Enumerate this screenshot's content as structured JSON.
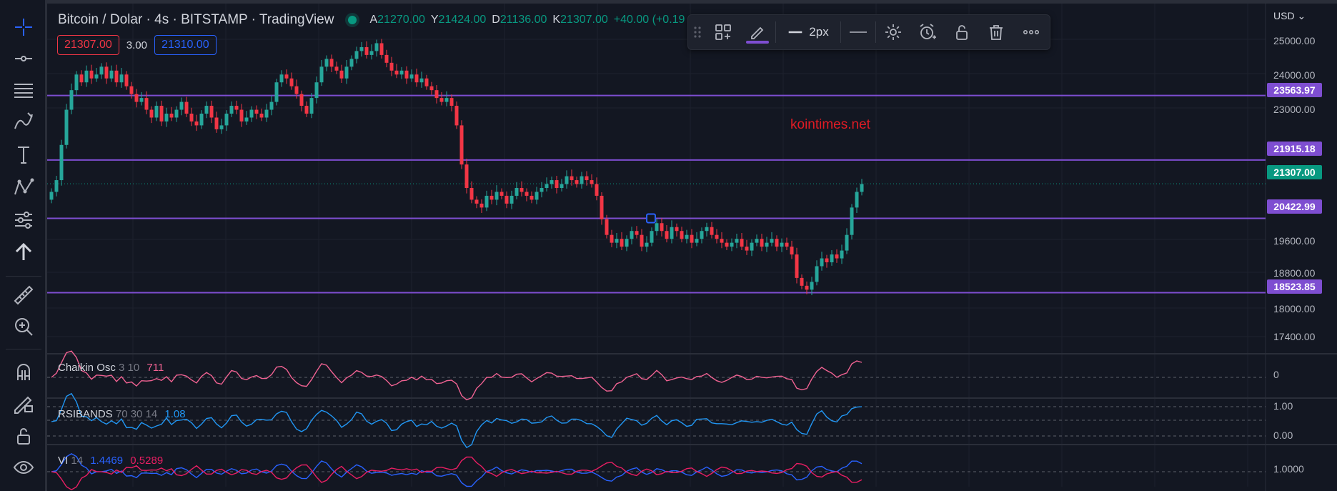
{
  "chart": {
    "symbol_title": "Bitcoin / Dolar · 4s · BITSTAMP · TradingView",
    "ohlc": [
      {
        "key": "A",
        "value": "21270.00"
      },
      {
        "key": "Y",
        "value": "21424.00"
      },
      {
        "key": "D",
        "value": "21136.00"
      },
      {
        "key": "K",
        "value": "21307.00"
      }
    ],
    "change": "+40.00 (+0.19",
    "sell_price": "21307.00",
    "spread": "3.00",
    "buy_price": "21310.00",
    "currency": "USD",
    "watermark": "kointimes.net"
  },
  "drawing_toolbar": {
    "stroke_width": "2px",
    "accent_color": "#7e4ed1",
    "icons": [
      "drag-handle-icon",
      "templates-icon",
      "pencil-icon",
      "line-width-icon",
      "line-style-icon",
      "gear-icon",
      "alarm-clock-icon",
      "unlock-icon",
      "trash-icon",
      "more-icon"
    ]
  },
  "left_toolbar": {
    "icons": [
      "crosshair-icon",
      "trend-line-icon",
      "fib-retracement-icon",
      "brush-icon",
      "text-icon",
      "pattern-icon",
      "forecast-icon",
      "arrow-up-icon",
      "ruler-icon",
      "zoom-in-icon",
      "magnet-icon",
      "lock-drawing-icon",
      "unlock-icon",
      "eye-icon"
    ]
  },
  "price_axis": {
    "ticks": [
      "25000.00",
      "24000.00",
      "23000.00",
      "19600.00",
      "18800.00",
      "18000.00",
      "17400.00"
    ],
    "horizontal_lines": [
      "23563.97",
      "21915.18",
      "20422.99",
      "18523.85"
    ],
    "current_price": "21307.00"
  },
  "indicators": [
    {
      "name": "Chaikin Osc",
      "params": "3 10",
      "value1": "711",
      "value2": "",
      "axis_labels": [
        "0"
      ]
    },
    {
      "name": "RSIBANDS",
      "params": "70 30 14",
      "value1": "1.08",
      "value2": "",
      "axis_labels": [
        "1.00",
        "0.00"
      ]
    },
    {
      "name": "VI",
      "params": "14",
      "value1": "1.4469",
      "value2": "0.5289",
      "axis_labels": [
        "1.0000"
      ]
    }
  ],
  "colors": {
    "background": "#131722",
    "up": "#26a69a",
    "down": "#f23645",
    "hline": "#7e4ed1",
    "chaikin": "#f06292",
    "rsi": "#2196f3",
    "vi_plus": "#2962ff",
    "vi_minus": "#e91e63"
  },
  "chart_data": {
    "type": "candlestick",
    "ylim": [
      17100,
      25400
    ],
    "closes": [
      21100,
      21400,
      22300,
      23200,
      23700,
      24100,
      23900,
      24200,
      24000,
      24100,
      24300,
      24000,
      24200,
      23900,
      24100,
      23800,
      23600,
      23400,
      23500,
      23200,
      23000,
      23300,
      22900,
      23100,
      23000,
      23200,
      23400,
      23100,
      22900,
      22800,
      23100,
      23300,
      23000,
      22700,
      22800,
      23100,
      23300,
      23200,
      22900,
      23000,
      23200,
      23100,
      23000,
      23200,
      23400,
      23900,
      24100,
      24000,
      23800,
      23600,
      23300,
      23100,
      23500,
      23900,
      24300,
      24500,
      24300,
      24200,
      24000,
      24300,
      24500,
      24700,
      24800,
      24600,
      24700,
      24900,
      24600,
      24400,
      24200,
      24100,
      24200,
      24000,
      24100,
      23900,
      24000,
      23800,
      23700,
      23500,
      23400,
      23500,
      23300,
      22800,
      21800,
      21200,
      20900,
      20800,
      20700,
      21000,
      20900,
      21100,
      21000,
      20800,
      21000,
      21200,
      21100,
      21000,
      20900,
      21100,
      21200,
      21300,
      21400,
      21200,
      21300,
      21500,
      21400,
      21300,
      21500,
      21400,
      21300,
      21000,
      20400,
      20000,
      19800,
      19900,
      19700,
      19900,
      20100,
      20000,
      19700,
      19800,
      20100,
      20300,
      20100,
      19900,
      20200,
      20100,
      19900,
      20000,
      19800,
      19900,
      20100,
      20200,
      20000,
      19900,
      19800,
      19700,
      19800,
      19900,
      19700,
      19600,
      19800,
      19900,
      19700,
      19800,
      19900,
      19700,
      19800,
      19700,
      19500,
      18900,
      18700,
      18600,
      18800,
      19200,
      19400,
      19300,
      19500,
      19400,
      19600,
      20000,
      20700,
      21100,
      21300
    ],
    "horizontal_levels": [
      23563.97,
      21915.18,
      20422.99,
      18523.85
    ],
    "current_price": 21307
  }
}
